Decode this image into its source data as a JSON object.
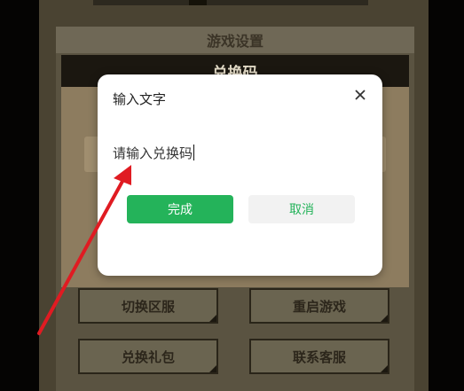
{
  "settings": {
    "title": "游戏设置"
  },
  "redeem_dialog": {
    "title": "兑换码"
  },
  "grid_buttons": [
    {
      "label": "切换区服"
    },
    {
      "label": "重启游戏"
    },
    {
      "label": "兑换礼包"
    },
    {
      "label": "联系客服"
    }
  ],
  "input_dialog": {
    "title": "输入文字",
    "input_text": "请输入兑换码",
    "ok_label": "完成",
    "cancel_label": "取消"
  },
  "colors": {
    "accent": "#24b35a",
    "arrow": "#e01b22"
  },
  "icons": {
    "close": "close-icon",
    "arrow": "red-arrow-annotation"
  }
}
